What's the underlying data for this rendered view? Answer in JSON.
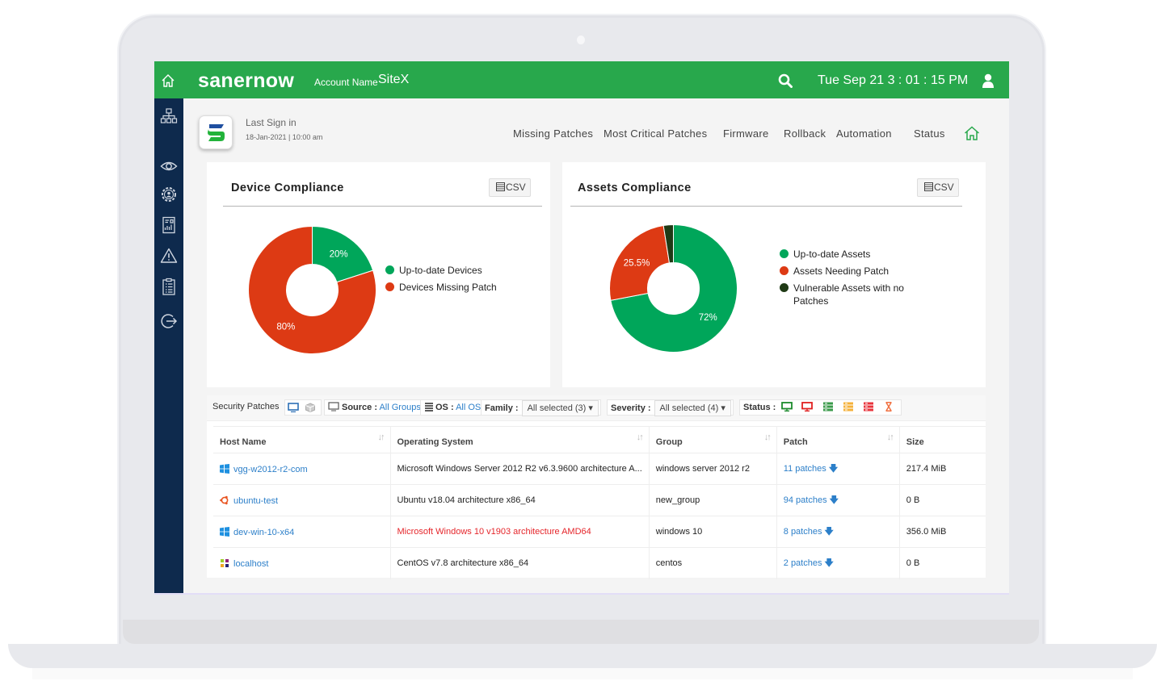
{
  "header": {
    "brand": "sanernow",
    "account_label": "Account Name",
    "account_name": "SiteX",
    "datetime": "Tue Sep 21  3 : 01 : 15 PM"
  },
  "sidebar": {
    "items": [
      {
        "icon": "network-icon",
        "label": "Network"
      },
      {
        "icon": "eye-icon",
        "label": "Visibility"
      },
      {
        "icon": "gear-user-icon",
        "label": "Management"
      },
      {
        "icon": "report-icon",
        "label": "Reports"
      },
      {
        "icon": "warning-icon",
        "label": "Alerts"
      },
      {
        "icon": "clipboard-icon",
        "label": "Tasks"
      },
      {
        "icon": "logout-icon",
        "label": "Logout"
      }
    ]
  },
  "subheader": {
    "last_sign_in_label": "Last Sign in",
    "last_sign_in_date": "18-Jan-2021 | 10:00 am",
    "nav": [
      "Missing Patches",
      "Most Critical Patches",
      "Firmware",
      "Rollback",
      "Automation",
      "Status"
    ]
  },
  "cards": {
    "device": {
      "title": "Device Compliance",
      "csv_label": "CSV"
    },
    "assets": {
      "title": "Assets Compliance",
      "csv_label": "CSV"
    }
  },
  "chart_data": [
    {
      "type": "pie",
      "title": "Device Compliance",
      "donut": true,
      "legend_position": "right",
      "categories": [
        "Up-to-date Devices",
        "Devices Missing Patch"
      ],
      "values": [
        20,
        80
      ],
      "labels": [
        "20%",
        "80%"
      ],
      "colors": [
        "#00a65a",
        "#dd3a14"
      ]
    },
    {
      "type": "pie",
      "title": "Assets Compliance",
      "donut": true,
      "legend_position": "right",
      "categories": [
        "Up-to-date Assets",
        "Assets Needing Patch",
        "Vulnerable Assets with no Patches"
      ],
      "values": [
        72,
        25.5,
        2.5
      ],
      "labels": [
        "72%",
        "25.5%",
        ""
      ],
      "colors": [
        "#00a65a",
        "#dd3a14",
        "#1f3a15"
      ]
    }
  ],
  "filters": {
    "title": "Security Patches",
    "source_label": "Source :",
    "source_value": "All Groups",
    "os_label": "OS :",
    "os_value": "All OS",
    "family_label": "Family :",
    "family_value": "All selected (3)",
    "severity_label": "Severity :",
    "severity_value": "All selected (4)",
    "status_label": "Status :"
  },
  "table": {
    "columns": [
      "Host Name",
      "Operating System",
      "Group",
      "Patch",
      "Size"
    ],
    "rows": [
      {
        "host": "vgg-w2012-r2-com",
        "os_icon": "windows-icon",
        "os": "Microsoft Windows Server 2012 R2 v6.3.9600 architecture A...",
        "group": "windows server 2012 r2",
        "patch": "11 patches",
        "size": "217.4 MiB",
        "highlight": false
      },
      {
        "host": "ubuntu-test",
        "os_icon": "ubuntu-icon",
        "os": "Ubuntu v18.04 architecture x86_64",
        "group": "new_group",
        "patch": "94 patches",
        "size": "0 B",
        "highlight": false
      },
      {
        "host": "dev-win-10-x64",
        "os_icon": "windows-icon",
        "os": "Microsoft Windows 10 v1903 architecture AMD64",
        "group": "windows 10",
        "patch": "8 patches",
        "size": "356.0 MiB",
        "highlight": true
      },
      {
        "host": "localhost",
        "os_icon": "centos-icon",
        "os": "CentOS v7.8 architecture x86_64",
        "group": "centos",
        "patch": "2 patches",
        "size": "0 B",
        "highlight": false
      }
    ]
  }
}
